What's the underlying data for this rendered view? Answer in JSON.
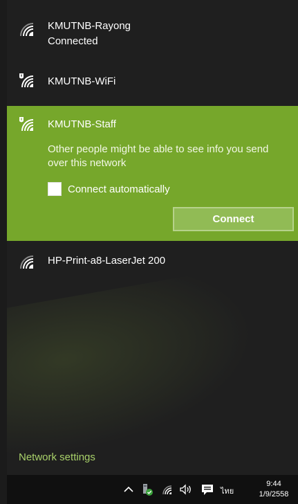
{
  "networks": [
    {
      "name": "KMUTNB-Rayong",
      "status": "Connected",
      "icon": "wifi-signal-icon"
    },
    {
      "name": "KMUTNB-WiFi",
      "icon": "wifi-secured-warning-icon"
    },
    {
      "name": "KMUTNB-Staff",
      "icon": "wifi-secured-warning-icon"
    },
    {
      "name": "HP-Print-a8-LaserJet 200",
      "icon": "wifi-signal-icon"
    }
  ],
  "selected": {
    "warning": "Other people might be able to see info you send over this network",
    "auto_connect_label": "Connect automatically",
    "auto_connect_checked": false,
    "connect_label": "Connect"
  },
  "network_settings_label": "Network settings",
  "taskbar": {
    "language": "ไทย",
    "time": "9:44",
    "date": "1/9/2558"
  },
  "colors": {
    "accent": "#76a72b",
    "link": "#a9d16a",
    "background": "#1f1f1f"
  }
}
